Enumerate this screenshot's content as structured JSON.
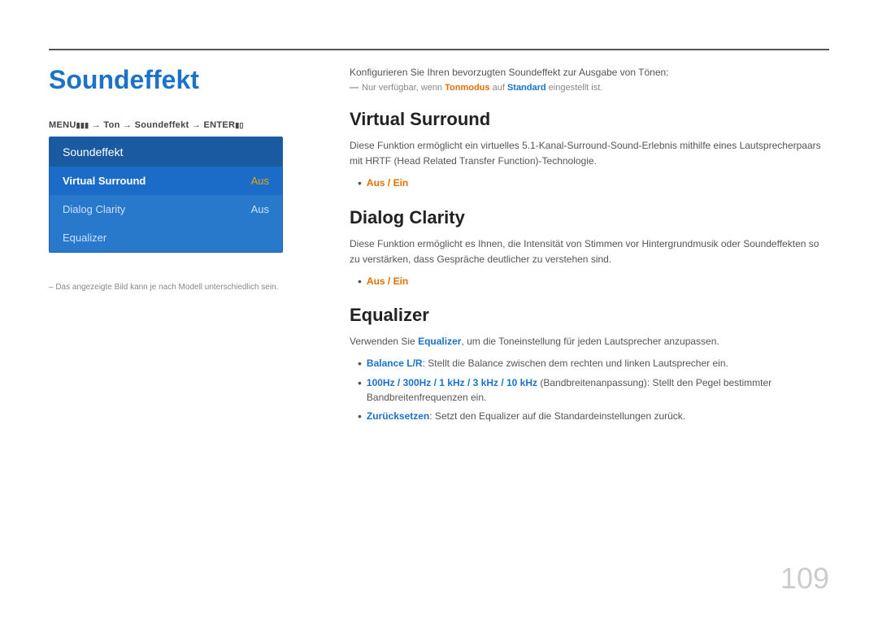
{
  "page": {
    "title": "Soundeffekt",
    "page_number": "109"
  },
  "menu": {
    "path": "MENU  → Ton → Soundeffekt → ENTER ",
    "header_label": "Soundeffekt",
    "items": [
      {
        "label": "Virtual Surround",
        "value": "Aus",
        "active": true
      },
      {
        "label": "Dialog Clarity",
        "value": "Aus",
        "active": false
      },
      {
        "label": "Equalizer",
        "value": "",
        "active": false
      }
    ]
  },
  "sidebar_note": "– Das angezeigte Bild kann je nach Modell unterschiedlich sein.",
  "intro": {
    "text": "Konfigurieren Sie Ihren bevorzugten Soundeffekt zur Ausgabe von Tönen:",
    "note": "Nur verfügbar, wenn Tonmodus auf Standard eingestellt ist."
  },
  "sections": [
    {
      "title": "Virtual Surround",
      "desc": "Diese Funktion ermöglicht ein virtuelles 5.1-Kanal-Surround-Sound-Erlebnis mithilfe eines Lautsprecherpaars mit HRTF (Head Related Transfer Function)-Technologie.",
      "bullets": [
        {
          "text": "Aus / Ein",
          "orange": true
        }
      ]
    },
    {
      "title": "Dialog Clarity",
      "desc": "Diese Funktion ermöglicht es Ihnen, die Intensität von Stimmen vor Hintergrundmusik oder Soundeffekten so zu verstärken, dass Gespräche deutlicher zu verstehen sind.",
      "bullets": [
        {
          "text": "Aus / Ein",
          "orange": true
        }
      ]
    },
    {
      "title": "Equalizer",
      "desc": "Verwenden Sie Equalizer, um die Toneinstellung für jeden Lautsprecher anzupassen.",
      "bullets": [
        {
          "text": "Balance L/R: Stellt die Balance zwischen dem rechten und linken Lautsprecher ein.",
          "blue_prefix": "Balance L/R"
        },
        {
          "text": "100Hz / 300Hz / 1 kHz / 3 kHz / 10 kHz (Bandbreitenanpassung): Stellt den Pegel bestimmter Bandbreitenfrequenzen ein.",
          "blue_prefix": "100Hz / 300Hz / 1 kHz / 3 kHz / 10 kHz"
        },
        {
          "text": "Zurücksetzen: Setzt den Equalizer auf die Standardeinstellungen zurück.",
          "blue_prefix": "Zurücksetzen"
        }
      ]
    }
  ]
}
